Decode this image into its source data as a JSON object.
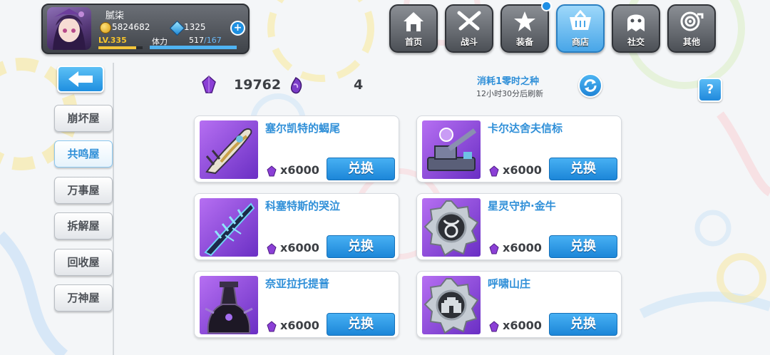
{
  "player": {
    "name": "腻柒",
    "gold": "5824682",
    "gems": "1325",
    "level": "LV.335",
    "stamina_label": "体力",
    "stamina_current": "517",
    "stamina_max": "/167",
    "level_progress": 0.85,
    "stamina_progress": 1.0
  },
  "menu": [
    {
      "label": "首页",
      "icon": "house-icon"
    },
    {
      "label": "战斗",
      "icon": "crossed-swords-icon"
    },
    {
      "label": "装备",
      "icon": "star-badge-icon"
    },
    {
      "label": "商店",
      "icon": "shop-basket-icon"
    },
    {
      "label": "社交",
      "icon": "ghost-icon"
    },
    {
      "label": "其他",
      "icon": "target-icon"
    }
  ],
  "sidebar": {
    "items": [
      {
        "label": "崩坏屋"
      },
      {
        "label": "共鸣屋"
      },
      {
        "label": "万事屋"
      },
      {
        "label": "拆解屋"
      },
      {
        "label": "回收屋"
      },
      {
        "label": "万神屋"
      }
    ],
    "active_index": 1
  },
  "currency": {
    "crystal_amount": "19762",
    "seed_amount": "4"
  },
  "info": {
    "cost_text": "消耗1零时之种",
    "refresh_text": "12小时30分后刷新"
  },
  "items": [
    {
      "name": "塞尔凯特的蝎尾",
      "price": "x6000",
      "button": "兑换",
      "icon": "scorpion-tail-weapon-icon"
    },
    {
      "name": "卡尔达舍夫信标",
      "price": "x6000",
      "button": "兑换",
      "icon": "beacon-cannon-icon"
    },
    {
      "name": "科塞特斯的哭泣",
      "price": "x6000",
      "button": "兑换",
      "icon": "ice-blade-icon"
    },
    {
      "name": "星灵守护·金牛",
      "price": "x6000",
      "button": "兑换",
      "icon": "taurus-medal-icon"
    },
    {
      "name": "奈亚拉托提普",
      "price": "x6000",
      "button": "兑换",
      "icon": "dark-armor-icon"
    },
    {
      "name": "呼啸山庄",
      "price": "x6000",
      "button": "兑换",
      "icon": "castle-medal-icon"
    }
  ],
  "colors": {
    "accent": "#2f8fd8",
    "button": "#1f8fe0",
    "item_bg": "#8a46d8"
  }
}
